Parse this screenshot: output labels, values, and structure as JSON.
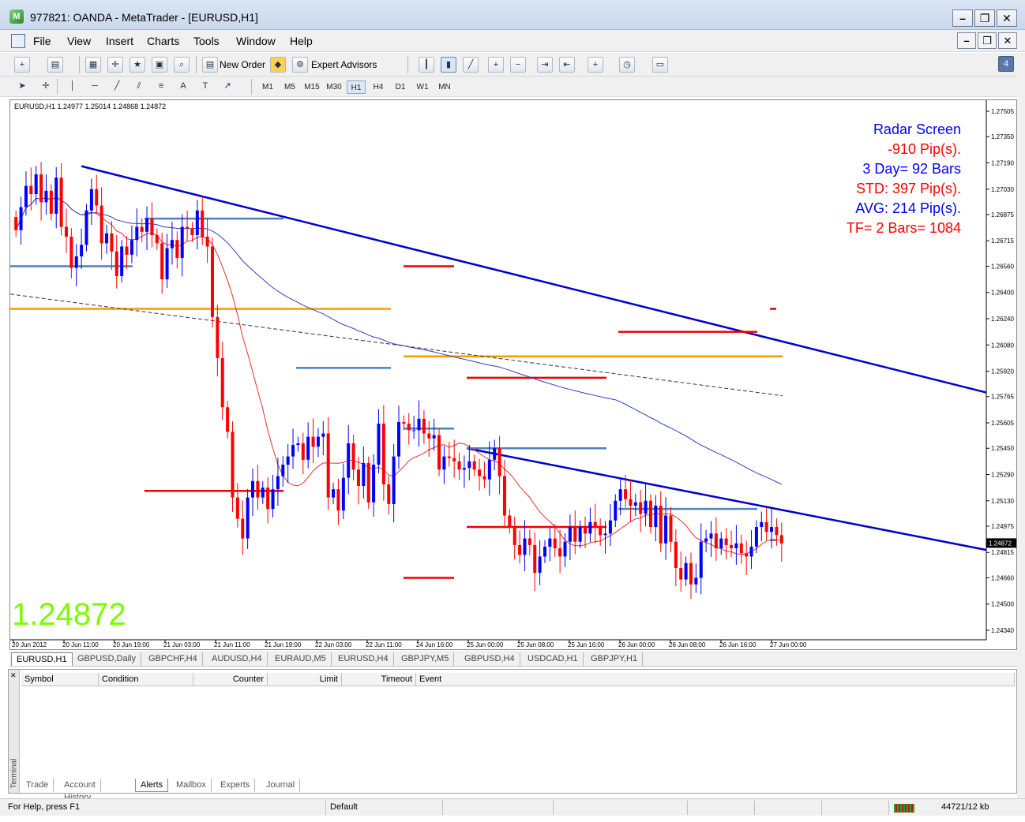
{
  "window": {
    "title": "977821: OANDA - MetaTrader - [EURUSD,H1]"
  },
  "menu": [
    "File",
    "View",
    "Insert",
    "Charts",
    "Tools",
    "Window",
    "Help"
  ],
  "toolbar": {
    "new_order": "New Order",
    "expert_advisors": "Expert Advisors",
    "badge": "4"
  },
  "timeframes": [
    "M1",
    "M5",
    "M15",
    "M30",
    "H1",
    "H4",
    "D1",
    "W1",
    "MN"
  ],
  "active_timeframe": "H1",
  "chart": {
    "header": "EURUSD,H1  1.24977 1.25014 1.24868 1.24872",
    "big_price": "1.24872",
    "current_price_label": "1.24872",
    "panel": [
      {
        "text": "Radar Screen",
        "color": "#0000ff"
      },
      {
        "text": "-910 Pip(s).",
        "color": "#ff0000"
      },
      {
        "text": "3 Day= 92 Bars",
        "color": "#0000ff"
      },
      {
        "text": "STD: 397 Pip(s).",
        "color": "#ff0000"
      },
      {
        "text": "AVG: 214 Pip(s).",
        "color": "#0000ff"
      },
      {
        "text": "TF= 2 Bars= 1084",
        "color": "#ff0000"
      }
    ]
  },
  "chart_data": {
    "type": "candlestick",
    "symbol": "EURUSD",
    "timeframe": "H1",
    "open": 1.24977,
    "high": 1.25014,
    "low": 1.24868,
    "close": 1.24872,
    "y_ticks": [
      "1.27505",
      "1.27350",
      "1.27190",
      "1.27030",
      "1.26875",
      "1.26715",
      "1.26560",
      "1.26400",
      "1.26240",
      "1.26080",
      "1.25920",
      "1.25765",
      "1.25605",
      "1.25450",
      "1.25290",
      "1.25130",
      "1.24975",
      "1.24815",
      "1.24660",
      "1.24500",
      "1.24340"
    ],
    "x_ticks": [
      "20 Jun 2012",
      "20 Jun 11:00",
      "20 Jun 19:00",
      "21 Jun 03:00",
      "21 Jun 11:00",
      "21 Jun 19:00",
      "22 Jun 03:00",
      "22 Jun 11:00",
      "24 Jun 16:00",
      "25 Jun 00:00",
      "25 Jun 08:00",
      "25 Jun 16:00",
      "26 Jun 00:00",
      "26 Jun 08:00",
      "26 Jun 16:00",
      "27 Jun 00:00"
    ],
    "ylim": [
      1.2434,
      1.27505
    ],
    "bull_color": "#0000ff",
    "bear_color": "#ff0000",
    "closes": [
      1.2678,
      1.2692,
      1.2705,
      1.27,
      1.2712,
      1.2695,
      1.2702,
      1.2688,
      1.271,
      1.268,
      1.2674,
      1.2655,
      1.2662,
      1.2669,
      1.269,
      1.2703,
      1.2693,
      1.267,
      1.2676,
      1.2665,
      1.265,
      1.2668,
      1.2663,
      1.2672,
      1.268,
      1.2677,
      1.2685,
      1.2675,
      1.267,
      1.2648,
      1.2667,
      1.2672,
      1.2661,
      1.268,
      1.2679,
      1.2675,
      1.269,
      1.2674,
      1.2668,
      1.2625,
      1.26,
      1.257,
      1.2555,
      1.2515,
      1.2502,
      1.249,
      1.2515,
      1.2525,
      1.2515,
      1.2521,
      1.2508,
      1.252,
      1.2528,
      1.2535,
      1.254,
      1.2547,
      1.2548,
      1.2538,
      1.2552,
      1.2546,
      1.2552,
      1.2554,
      1.2515,
      1.252,
      1.2507,
      1.2527,
      1.2548,
      1.2532,
      1.2522,
      1.2536,
      1.2512,
      1.2535,
      1.256,
      1.2523,
      1.2511,
      1.254,
      1.2561,
      1.256,
      1.2556,
      1.2556,
      1.2563,
      1.2554,
      1.2551,
      1.2553,
      1.2532,
      1.254,
      1.2539,
      1.2537,
      1.2532,
      1.2533,
      1.2537,
      1.2532,
      1.2528,
      1.2526,
      1.2538,
      1.2545,
      1.2528,
      1.2504,
      1.2497,
      1.2486,
      1.248,
      1.249,
      1.2486,
      1.2469,
      1.2479,
      1.2485,
      1.249,
      1.2484,
      1.2479,
      1.2488,
      1.2497,
      1.2488,
      1.2497,
      1.2493,
      1.25,
      1.2497,
      1.2492,
      1.2493,
      1.2501,
      1.2513,
      1.252,
      1.2514,
      1.251,
      1.2512,
      1.2505,
      1.2513,
      1.2497,
      1.251,
      1.2487,
      1.2504,
      1.2488,
      1.2472,
      1.2465,
      1.2475,
      1.2462,
      1.2466,
      1.2488,
      1.249,
      1.2493,
      1.2484,
      1.249,
      1.2486,
      1.2484,
      1.2487,
      1.2481,
      1.2479,
      1.2485,
      1.2497,
      1.25,
      1.2494,
      1.2497,
      1.2492,
      1.2487
    ]
  },
  "chart_tabs": [
    "EURUSD,H1",
    "GBPUSD,Daily",
    "GBPCHF,H4",
    "AUDUSD,H4",
    "EURAUD,M5",
    "EURUSD,H4",
    "GBPJPY,M5",
    "GBPUSD,H4",
    "USDCAD,H1",
    "GBPJPY,H1"
  ],
  "terminal": {
    "side_label": "Terminal",
    "columns": [
      "Symbol",
      "Condition",
      "Counter",
      "Limit",
      "Timeout",
      "Event"
    ],
    "tabs": [
      "Trade",
      "Account History",
      "Alerts",
      "Mailbox",
      "Experts",
      "Journal"
    ],
    "active_tab": "Alerts"
  },
  "status": {
    "help": "For Help, press F1",
    "profile": "Default",
    "traffic": "44721/12 kb"
  }
}
